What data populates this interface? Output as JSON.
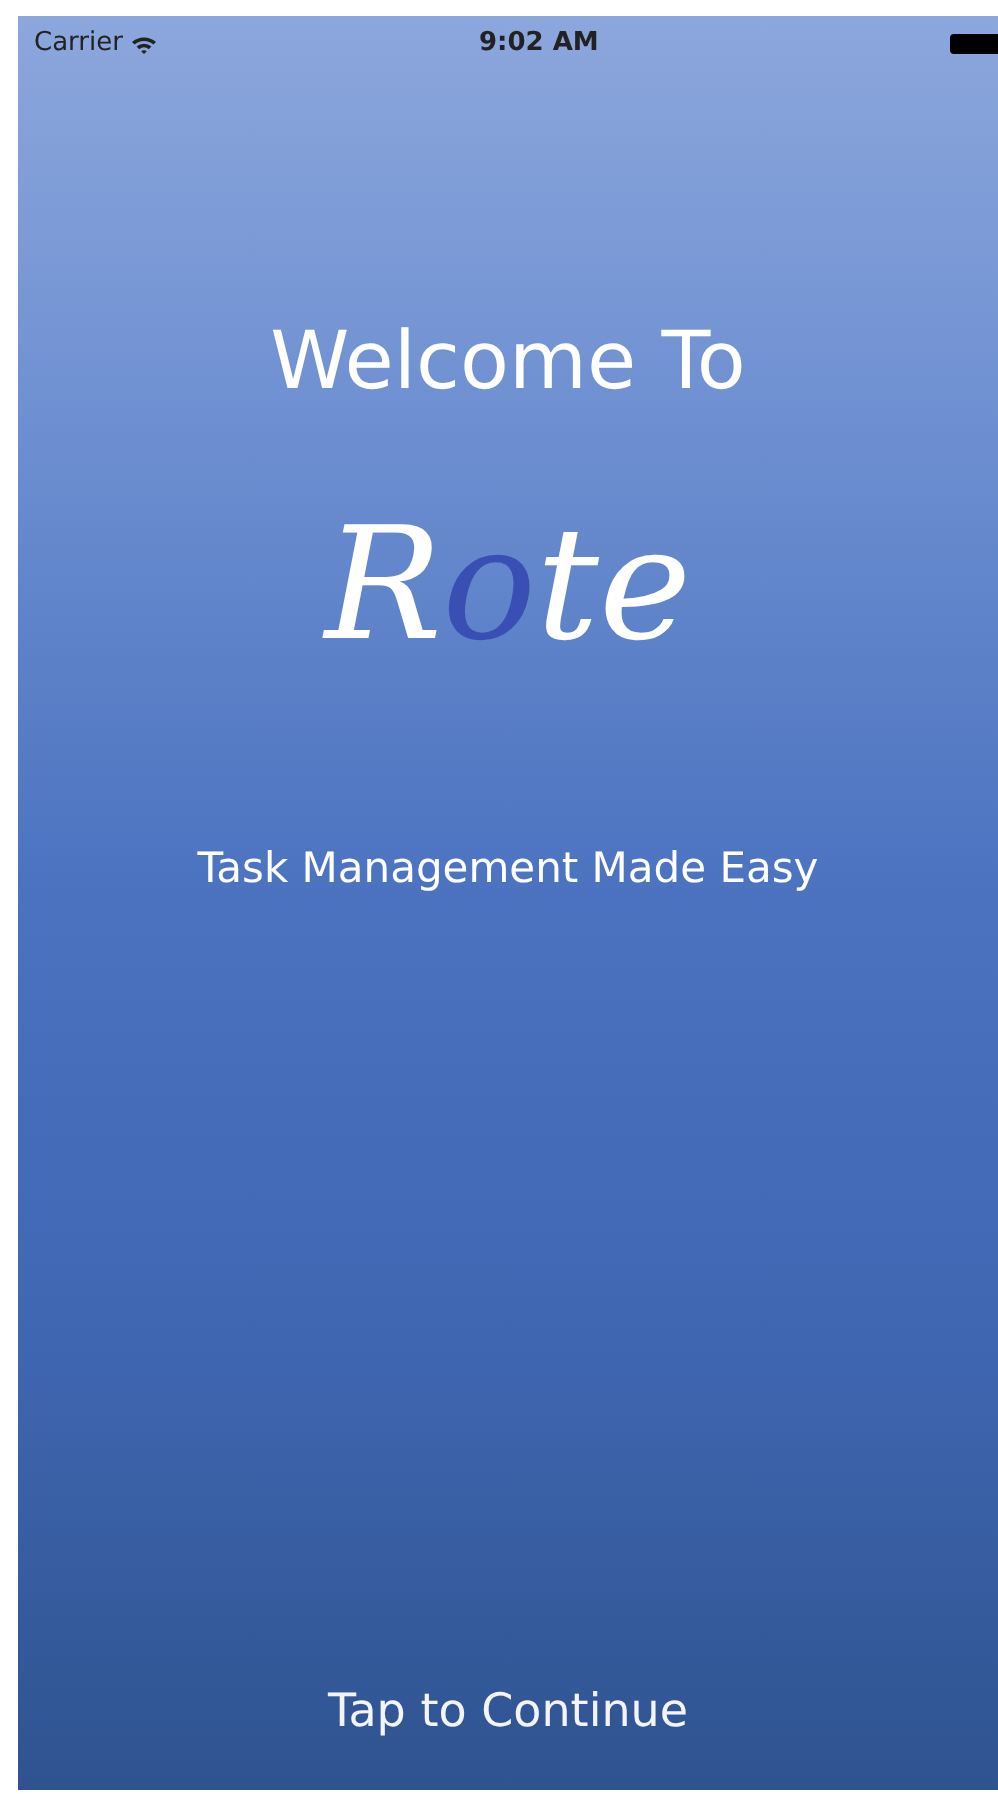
{
  "status_bar": {
    "carrier": "Carrier",
    "time": "9:02 AM"
  },
  "title": "Welcome To",
  "logo": [
    {
      "text": "R",
      "color": "#ffffff"
    },
    {
      "text": "o",
      "color": "#3a4fb4"
    },
    {
      "text": "te",
      "color": "#ffffff"
    }
  ],
  "tagline": "Task Management Made Easy",
  "continue_button": "Tap to Continue"
}
